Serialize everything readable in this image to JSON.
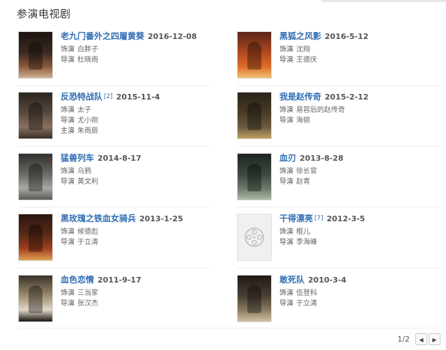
{
  "section": {
    "title": "参演电视剧"
  },
  "films": [
    {
      "title": "老九门番外之四屠黄葵",
      "date": "2016-12-08",
      "footnote": "",
      "roles": [
        {
          "label": "饰演",
          "name": "白胖子"
        },
        {
          "label": "导演",
          "name": "杜晓雨"
        }
      ],
      "poster": {
        "colors": [
          "#1c1410",
          "#3a2a22",
          "#8a5a3a",
          "#d0b090"
        ]
      }
    },
    {
      "title": "黑狐之风影",
      "date": "2016-5-12",
      "footnote": "",
      "roles": [
        {
          "label": "饰演",
          "name": "沈翔"
        },
        {
          "label": "导演",
          "name": "王德庆"
        }
      ],
      "poster": {
        "colors": [
          "#5a2418",
          "#b04a20",
          "#e06a2a",
          "#f0c070"
        ]
      }
    },
    {
      "title": "反恐特战队",
      "date": "2015-11-4",
      "footnote": "[2]",
      "roles": [
        {
          "label": "饰演",
          "name": "太子"
        },
        {
          "label": "导演",
          "name": "尤小刚"
        },
        {
          "label": "主演",
          "name": "朱雨辰"
        }
      ],
      "poster": {
        "colors": [
          "#2a2520",
          "#5a4a40",
          "#8a7060",
          "#3a2f28"
        ]
      }
    },
    {
      "title": "我是赵传奇",
      "date": "2015-2-12",
      "footnote": "",
      "roles": [
        {
          "label": "饰演",
          "name": "易容后的赵传奇"
        },
        {
          "label": "导演",
          "name": "海顿"
        }
      ],
      "poster": {
        "colors": [
          "#2a2418",
          "#4a3c28",
          "#6a5a40",
          "#c0a060"
        ]
      }
    },
    {
      "title": "猛兽列车",
      "date": "2014-8-17",
      "footnote": "",
      "roles": [
        {
          "label": "饰演",
          "name": "乌鸦"
        },
        {
          "label": "导演",
          "name": "黄文利"
        }
      ],
      "poster": {
        "colors": [
          "#30302e",
          "#6a6a66",
          "#a8a8a4",
          "#5a5a56"
        ]
      }
    },
    {
      "title": "血刃",
      "date": "2013-8-28",
      "footnote": "",
      "roles": [
        {
          "label": "饰演",
          "name": "徐长官"
        },
        {
          "label": "导演",
          "name": "赵青"
        }
      ],
      "poster": {
        "colors": [
          "#1e2420",
          "#3c4a40",
          "#6a7a6a",
          "#b0b8a8"
        ]
      }
    },
    {
      "title": "黑玫瑰之铁血女骑兵",
      "date": "2013-1-25",
      "footnote": "",
      "roles": [
        {
          "label": "饰演",
          "name": "候德彪"
        },
        {
          "label": "导演",
          "name": "于立清"
        }
      ],
      "poster": {
        "colors": [
          "#2a1810",
          "#5a2a18",
          "#a04020",
          "#e0a050"
        ]
      }
    },
    {
      "title": "干得漂亮",
      "date": "2012-3-5",
      "footnote": "[7]",
      "roles": [
        {
          "label": "饰演",
          "name": "棍儿"
        },
        {
          "label": "导演",
          "name": "李海峰"
        }
      ],
      "poster": {
        "colors": []
      }
    },
    {
      "title": "血色恋情",
      "date": "2011-9-17",
      "footnote": "",
      "roles": [
        {
          "label": "饰演",
          "name": "三当家"
        },
        {
          "label": "导演",
          "name": "张汉杰"
        }
      ],
      "poster": {
        "colors": [
          "#3a3228",
          "#a09070",
          "#e0d8c8",
          "#1a1410"
        ]
      }
    },
    {
      "title": "敢死队",
      "date": "2010-3-4",
      "footnote": "",
      "roles": [
        {
          "label": "饰演",
          "name": "伍登科"
        },
        {
          "label": "导演",
          "name": "于立清"
        }
      ],
      "poster": {
        "colors": [
          "#1e1a16",
          "#4a4034",
          "#8a7a60",
          "#d0c0a0"
        ]
      }
    }
  ],
  "pager": {
    "current": "1",
    "separator": "/",
    "total": "2",
    "prev_icon": "◀",
    "next_icon": "▶"
  }
}
